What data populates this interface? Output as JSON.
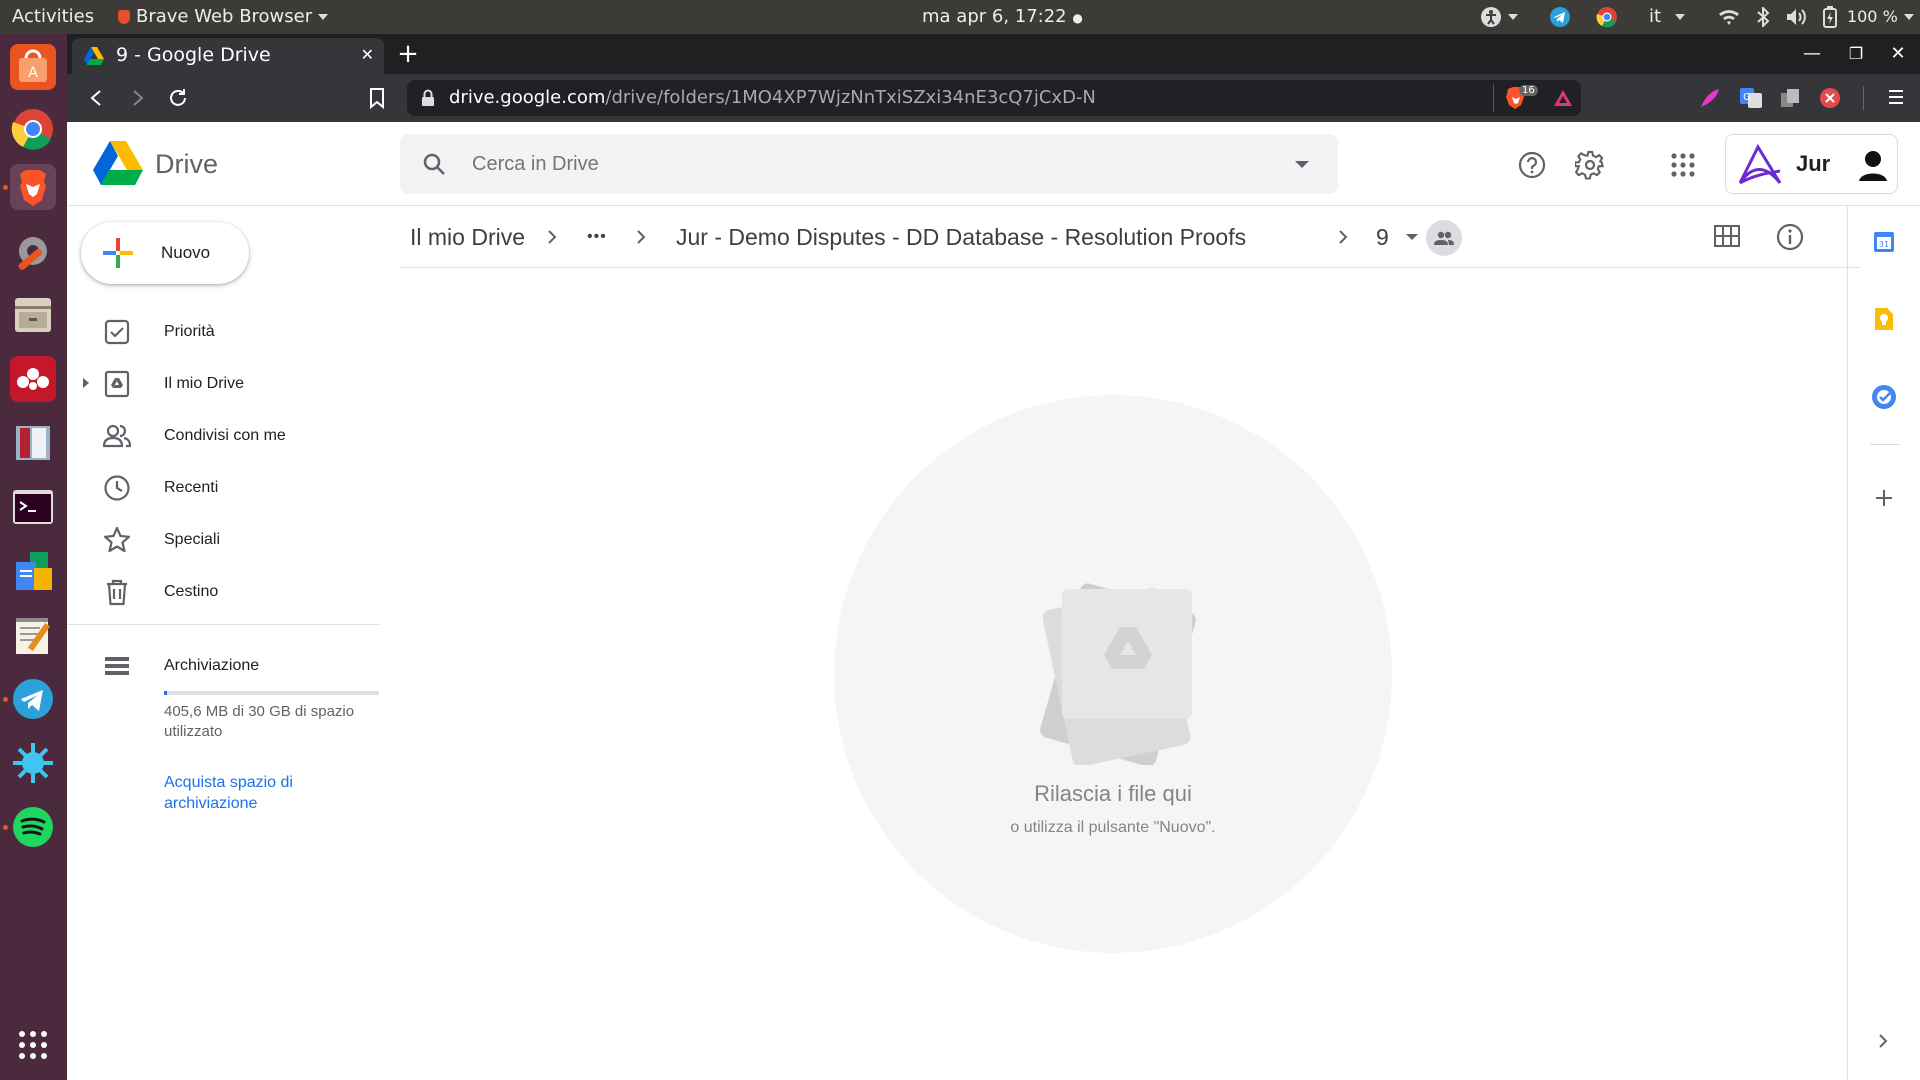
{
  "topbar": {
    "activities": "Activities",
    "app_name": "Brave Web Browser",
    "clock": "ma apr  6, 17:22",
    "lang": "it",
    "battery": "100 %"
  },
  "browser": {
    "tab_title": "9 - Google Drive",
    "url_domain": "drive.google.com",
    "url_path": "/drive/folders/1MO4XP7WjzNnTxiSZxi34nE3cQ7jCxD-N",
    "shield_count": "16"
  },
  "drive": {
    "logo_text": "Drive",
    "search_placeholder": "Cerca in Drive",
    "account_name": "Jur",
    "new_button": "Nuovo",
    "nav": [
      {
        "label": "Priorità",
        "icon": "priority-icon"
      },
      {
        "label": "Il mio Drive",
        "icon": "my-drive-icon"
      },
      {
        "label": "Condivisi con me",
        "icon": "shared-icon"
      },
      {
        "label": "Recenti",
        "icon": "clock-icon"
      },
      {
        "label": "Speciali",
        "icon": "star-icon"
      },
      {
        "label": "Cestino",
        "icon": "trash-icon"
      }
    ],
    "storage": {
      "label": "Archiviazione",
      "usage_text": "405,6 MB di 30 GB di spazio utilizzato",
      "used_fraction": 0.0135,
      "buy_link": "Acquista spazio di archiviazione"
    },
    "breadcrumb": {
      "root": "Il mio Drive",
      "ellipsis": "•••",
      "parent": "Jur - Demo Disputes - DD Database - Resolution Proofs",
      "current": "9"
    },
    "empty_state": {
      "title": "Rilascia i file qui",
      "subtitle": "o utilizza il pulsante \"Nuovo\"."
    }
  },
  "colors": {
    "accent_blue": "#1a73e8",
    "dock_bg": "#4c2a3d",
    "topbar_bg": "#3c3b37"
  }
}
